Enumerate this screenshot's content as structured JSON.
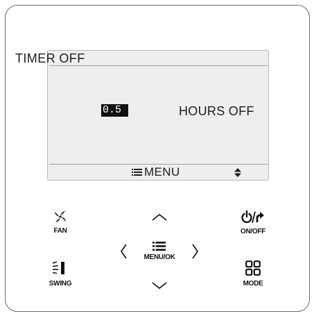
{
  "screen": {
    "title": "TIMER OFF",
    "timer_value": "0.5",
    "unit_label": "HOURS OFF",
    "footer_label": "MENU"
  },
  "buttons": {
    "fan": "FAN",
    "power": "ON/OFF",
    "menu_ok": "MENU/OK",
    "swing": "SWING",
    "mode": "MODE"
  },
  "icons": {
    "fan": "fan-icon",
    "power": "power-back-icon",
    "menu": "menu-icon",
    "swing": "swing-icon",
    "mode": "mode-grid-icon",
    "up": "chevron-up-icon",
    "down": "chevron-down-icon",
    "left": "chevron-left-icon",
    "right": "chevron-right-icon",
    "scroll": "up-down-arrows-icon"
  },
  "colors": {
    "lcd_background": "#eeeeee",
    "text": "#1c1c1c",
    "highlight": "#111111"
  }
}
